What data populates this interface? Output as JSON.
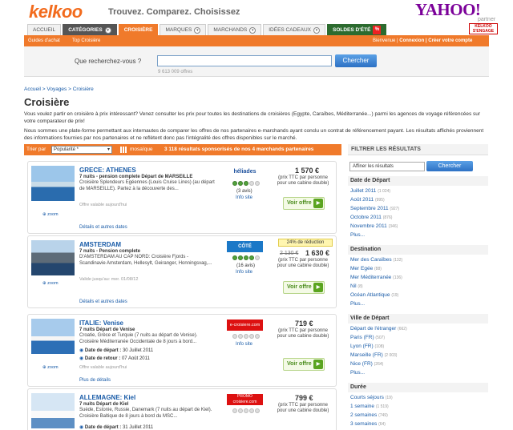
{
  "header": {
    "logo": "kelkoo",
    "tagline": "Trouvez. Comparez. Choisissez",
    "partner_logo": "YAHOO!",
    "partner_label": "partner",
    "badge": "KELKOO S'ENGAGE"
  },
  "tabs": [
    {
      "label": "ACCUEIL",
      "dropdown": false
    },
    {
      "label": "CATÉGORIES",
      "dropdown": true
    },
    {
      "label": "CROISIÈRE",
      "dropdown": false,
      "active": true
    },
    {
      "label": "MARQUES",
      "dropdown": true
    },
    {
      "label": "MARCHANDS",
      "dropdown": true
    },
    {
      "label": "IDÉES CADEAUX",
      "dropdown": true
    },
    {
      "label": "SOLDES D'ÉTÉ",
      "dropdown": false
    }
  ],
  "subnav": {
    "guides": "Guides d'achat",
    "top": "Top Croisière",
    "welcome": "Bienvenue | ",
    "connexion": "Connexion",
    "account": " | Créer votre compte"
  },
  "search": {
    "question": "Que recherchez-vous ?",
    "value": "",
    "button": "Chercher",
    "count": "9 613 009 offres"
  },
  "breadcrumb": "Accueil > Voyages > Croisière",
  "page_title": "Croisière",
  "intro1": "Vous voulez partir en croisière à prix intéressant? Venez consulter les prix pour toutes les destinations de croisières (Egypte, Caraïbes, Méditerranée...) parmi les agences de voyage référencées sur votre comparateur de prix!",
  "intro2": "Nous sommes une plate-forme permettant aux internautes de comparer les offres de nos partenaires e-marchands ayant conclu un contrat de référencement payant. Les résultats affichés proviennent des informations fournies par nos partenaires et ne reflètent donc pas l'intégralité des offres disponibles sur le marché.",
  "sort": {
    "label": "Trier par",
    "selected": "Popularité *",
    "mosaic": "mosaïque",
    "results": "3 118 résultats sponsorisés de nos 4 marchands partenaires"
  },
  "results": [
    {
      "title": "GRECE: ATHENES",
      "sub": "7 nuits - pension complete Départ de MARSEILLE",
      "desc": "Croisière Splendeurs Egéennes (Louis Cruise Lines) (au départ de MARSEILLE). Partez à la découverte des...",
      "valid": "Offre valable aujourd'hui",
      "details": "Détails et autres dates",
      "merchant": "héliades",
      "merchant_color": "#1b4f9c",
      "avis": "(3 avis)",
      "info": "Info site",
      "price": "1 570 €",
      "ptxt": "(prix TTC par personne pour une cabine double)",
      "voir": "Voir offre",
      "zoom": "zoom",
      "stars": 3
    },
    {
      "title": "AMSTERDAM",
      "sub": "7 nuits - Pension complete",
      "desc": "D'AMSTERDAM AU CAP NORD: Croisière Fjords - Scandinavie Amsterdam, Hellesylt, Geiranger, Honningsvag,...",
      "valid": "Valide jusqu'au: mer. 01/08/12",
      "details": "Détails et autres dates",
      "merchant": "CÔTÉ CROISIÈRE",
      "merchant_color": "#1b78c7",
      "avis": "(16 avis)",
      "info": "Info site",
      "discount": "24% de réduction",
      "old_price": "2 130 €",
      "price": "1 630 €",
      "ptxt": "(prix TTC par personne pour une cabine double)",
      "voir": "Voir offre",
      "zoom": "zoom",
      "stars": 4
    },
    {
      "title": "ITALIE: Venise",
      "sub": "7 nuits Départ de Venise",
      "desc": "Croatie, Grèce et Turquie (7 nuits au départ de Venise). Croisière Méditerranée Occidentale de 8 jours à bord...",
      "dep_label": "Date de départ :",
      "dep": "30 Juillet 2011",
      "ret_label": "Date de retour :",
      "ret": "07 Août 2011",
      "valid": "Offre valable aujourd'hui",
      "details": "Plus de détails",
      "merchant": "e-croisiere.com",
      "merchant_color": "#d11",
      "info": "Info site",
      "price": "719 €",
      "ptxt": "(prix TTC par personne pour une cabine double)",
      "voir": "Voir offre",
      "zoom": "zoom",
      "stars": 0
    },
    {
      "title": "ALLEMAGNE: Kiel",
      "sub": "7 nuits Départ de Kiel",
      "desc": "Suède, Estonie, Russie, Danemark (7 nuits au départ de Kiel). Croisière Baltique de 8 jours à bord du MSC...",
      "dep_label": "Date de départ :",
      "dep": "31 Juillet 2011",
      "merchant": "PROMO croisiere.com",
      "merchant_color": "#d11",
      "price": "799 €",
      "ptxt": "(prix TTC par personne pour une cabine double)",
      "zoom": "zoom",
      "stars": 0
    }
  ],
  "sidebar": {
    "title": "FILTRER LES RÉSULTATS",
    "filter_value": "Affiner les résultats",
    "filter_button": "Chercher",
    "groups": [
      {
        "title": "Date de Départ",
        "items": [
          [
            "Juillet 2011",
            "(1 024)"
          ],
          [
            "Août 2011",
            "(995)"
          ],
          [
            "Septembre 2011",
            "(927)"
          ],
          [
            "Octobre 2011",
            "(876)"
          ],
          [
            "Novembre 2011",
            "(346)"
          ],
          [
            "Plus...",
            ""
          ]
        ]
      },
      {
        "title": "Destination",
        "items": [
          [
            "Mer des Caraïbes",
            "(132)"
          ],
          [
            "Mer Egée",
            "(88)"
          ],
          [
            "Mer Méditerranée",
            "(136)"
          ],
          [
            "Nil",
            "(8)"
          ],
          [
            "Océan Atlantique",
            "(19)"
          ],
          [
            "Plus...",
            ""
          ]
        ]
      },
      {
        "title": "Ville de Départ",
        "items": [
          [
            "Départ de l'étranger",
            "(662)"
          ],
          [
            "Paris (FR)",
            "(507)"
          ],
          [
            "Lyon (FR)",
            "(108)"
          ],
          [
            "Marseille (FR)",
            "(2 003)"
          ],
          [
            "Nice (FR)",
            "(264)"
          ],
          [
            "Plus...",
            ""
          ]
        ]
      },
      {
        "title": "Durée",
        "items": [
          [
            "Courts séjours",
            "(19)"
          ],
          [
            "1 semaine",
            "(1 519)"
          ],
          [
            "2 semaines",
            "(749)"
          ],
          [
            "3 semaines",
            "(64)"
          ]
        ]
      }
    ]
  }
}
